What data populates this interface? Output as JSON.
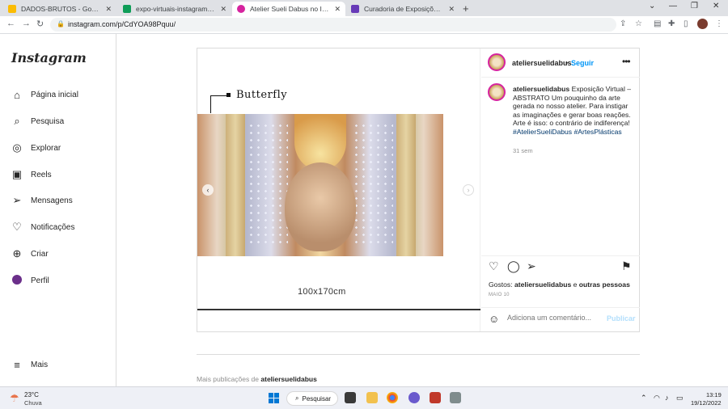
{
  "browser": {
    "tabs": [
      {
        "title": "DADOS-BRUTOS - Google Drive",
        "favicon_color": "#fbbc04",
        "active": false
      },
      {
        "title": "expo-virtuais-instagram-2022 - I",
        "favicon_color": "#0f9d58",
        "active": false
      },
      {
        "title": "Atelier Sueli Dabus no Instagram",
        "favicon_color": "#d6249f",
        "active": true
      },
      {
        "title": "Curadoria de Exposições Online",
        "favicon_color": "#673ab7",
        "active": false
      }
    ],
    "url": "instagram.com/p/CdYOA98Pquu/"
  },
  "sidebar": {
    "logo": "Instagram",
    "items": [
      {
        "label": "Página inicial",
        "icon": "home-icon"
      },
      {
        "label": "Pesquisa",
        "icon": "search-icon"
      },
      {
        "label": "Explorar",
        "icon": "compass-icon"
      },
      {
        "label": "Reels",
        "icon": "reels-icon"
      },
      {
        "label": "Mensagens",
        "icon": "send-icon"
      },
      {
        "label": "Notificações",
        "icon": "heart-icon"
      },
      {
        "label": "Criar",
        "icon": "plus-icon"
      },
      {
        "label": "Perfil",
        "icon": "profile-icon"
      }
    ],
    "more": "Mais"
  },
  "post": {
    "artwork_title": "Butterfly",
    "artwork_dimensions": "100x170cm",
    "author": "ateliersuelidabus",
    "follow_label": "Seguir",
    "bullet": "•",
    "caption_author": "ateliersuelidabus",
    "caption_text": "Exposição Virtual – ABSTRATO Um pouquinho da arte gerada no nosso atelier. Para instigar as imaginações e gerar boas reações. Arte é isso: o contrário de indiferença!",
    "caption_tags": "#AtelierSueliDabus #ArtesPlásticas",
    "age": "31 sem",
    "likes_prefix": "Gostos:",
    "likes_user": "ateliersuelidabus",
    "likes_and": "e",
    "likes_others": "outras pessoas",
    "date": "MAIO 10",
    "comment_placeholder": "Adiciona um comentário...",
    "publish_label": "Publicar"
  },
  "more_posts": {
    "prefix": "Mais publicações de",
    "user": "ateliersuelidabus"
  },
  "taskbar": {
    "weather_temp": "23°C",
    "weather_desc": "Chuva",
    "search_label": "Pesquisar",
    "time": "13:19",
    "date": "19/12/2022"
  }
}
